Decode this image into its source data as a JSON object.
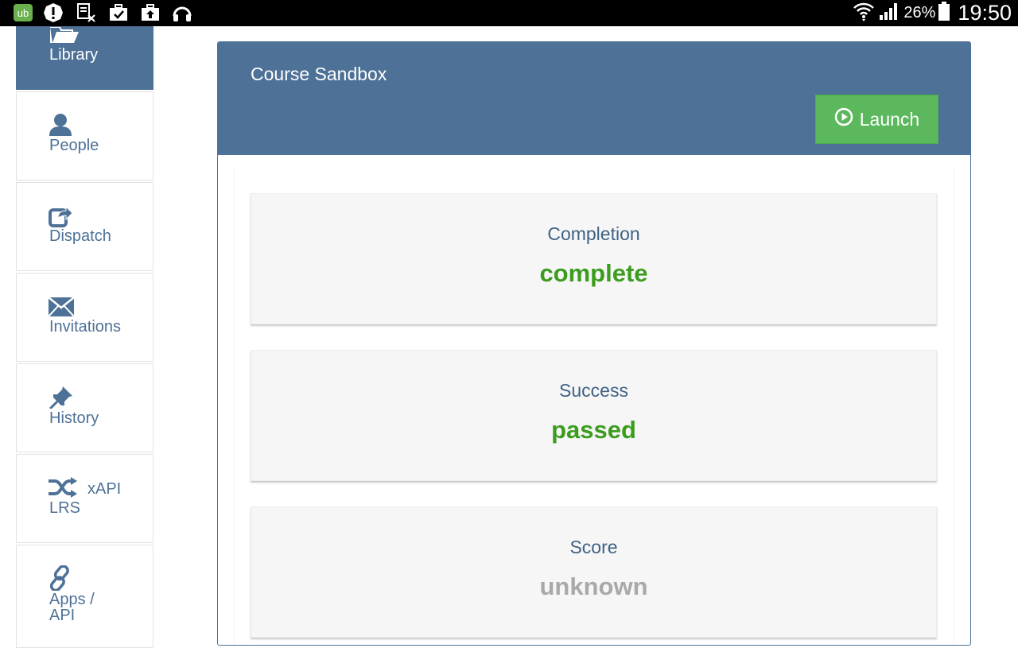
{
  "status_bar": {
    "battery_percent": "26%",
    "time": "19:50",
    "left_icons": [
      "ub-app-icon",
      "alert-icon",
      "document-x-icon",
      "briefcase-check-icon",
      "briefcase-upload-icon",
      "headphones-icon"
    ],
    "right_icons": [
      "wifi-icon",
      "signal-icon",
      "battery-icon"
    ]
  },
  "sidebar": {
    "items": [
      {
        "label": "Library",
        "icon": "folder-open-icon",
        "active": true
      },
      {
        "label": "People",
        "icon": "person-icon",
        "active": false
      },
      {
        "label": "Dispatch",
        "icon": "share-icon",
        "active": false
      },
      {
        "label": "Invitations",
        "icon": "envelope-icon",
        "active": false
      },
      {
        "label": "History",
        "icon": "pushpin-icon",
        "active": false
      },
      {
        "label_line1": "xAPI",
        "label_line2": "LRS",
        "icon": "shuffle-icon",
        "active": false
      },
      {
        "label_line1": "Apps /",
        "label_line2": "API",
        "icon": "link-icon",
        "active": false
      }
    ]
  },
  "panel": {
    "title": "Course Sandbox",
    "launch_label": "Launch",
    "launch_icon": "play-circle-icon"
  },
  "stats": [
    {
      "label": "Completion",
      "value": "complete",
      "color": "#3c9c1e"
    },
    {
      "label": "Success",
      "value": "passed",
      "color": "#3c9c1e"
    },
    {
      "label": "Score",
      "value": "unknown",
      "color": "#a9a9a9"
    }
  ],
  "colors": {
    "accent": "#4e7197",
    "launch_green": "#5cb85c",
    "status_bar": "#000000"
  }
}
